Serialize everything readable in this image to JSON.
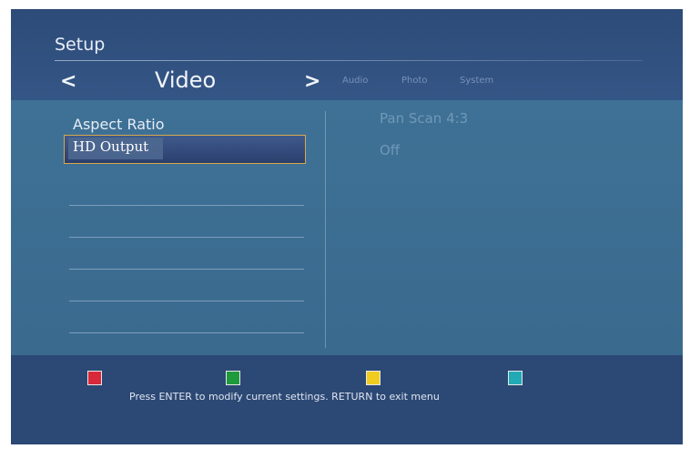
{
  "header": {
    "title": "Setup",
    "nav_prev": "<",
    "nav_next": ">",
    "active_tab": "Video",
    "tabs": [
      "Audio",
      "Photo",
      "System"
    ]
  },
  "menu": {
    "items": [
      {
        "label": "Aspect Ratio",
        "value": "Pan Scan 4:3"
      },
      {
        "label": "HD Output",
        "value": "Off"
      }
    ]
  },
  "footer": {
    "keys": [
      "red-key-icon",
      "green-key-icon",
      "yellow-key-icon",
      "cyan-key-icon"
    ],
    "hint": "Press ENTER to modify current settings. RETURN to exit menu"
  },
  "colors": {
    "background": "#2f4f7c",
    "content": "#3f7196",
    "highlight_border": "#d7a94a",
    "red": "#d8283a",
    "green": "#1e9a3c",
    "yellow": "#f0cc20",
    "cyan": "#22a9b6"
  }
}
